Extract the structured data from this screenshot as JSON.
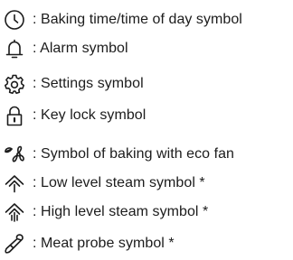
{
  "legend": {
    "items": [
      {
        "icon": "clock-icon",
        "label": ": Baking time/time of day symbol"
      },
      {
        "icon": "bell-icon",
        "label": ": Alarm symbol"
      },
      {
        "icon": "gear-icon",
        "label": ": Settings symbol"
      },
      {
        "icon": "padlock-icon",
        "label": ": Key lock symbol"
      },
      {
        "icon": "eco-fan-icon",
        "label": ": Symbol of baking with eco fan"
      },
      {
        "icon": "low-steam-icon",
        "label": ": Low level steam symbol *"
      },
      {
        "icon": "high-steam-icon",
        "label": ": High level steam symbol *"
      },
      {
        "icon": "meat-probe-icon",
        "label": ": Meat probe symbol *"
      }
    ]
  }
}
